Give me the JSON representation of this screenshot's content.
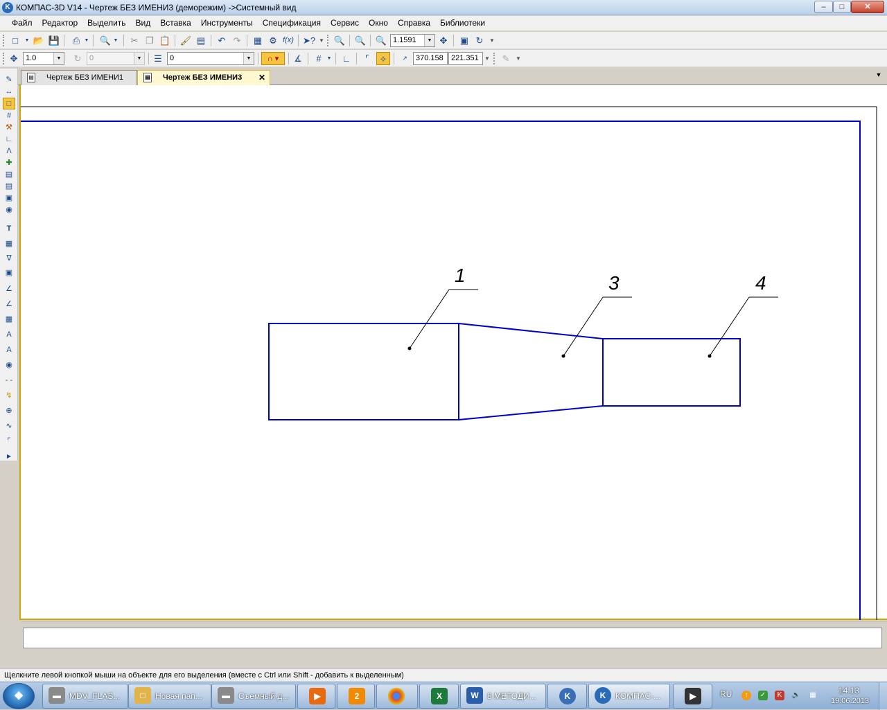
{
  "window": {
    "title": "КОМПАС-3D V14 - Чертеж БЕЗ ИМЕНИ3 (деморежим) ->Системный вид",
    "app_icon_letter": "K"
  },
  "menu": [
    "Файл",
    "Редактор",
    "Выделить",
    "Вид",
    "Вставка",
    "Инструменты",
    "Спецификация",
    "Сервис",
    "Окно",
    "Справка",
    "Библиотеки"
  ],
  "toolbar1": {
    "zoom_value": "1.1591"
  },
  "toolbar2": {
    "step_value": "1.0",
    "angle_value": "0",
    "layer_value": "0",
    "coord_x": "370.158",
    "coord_y": "221.351"
  },
  "tabs": [
    {
      "label": "Чертеж БЕЗ ИМЕНИ1",
      "active": false
    },
    {
      "label": "Чертеж БЕЗ ИМЕНИ3",
      "active": true
    }
  ],
  "drawing": {
    "labels": [
      "1",
      "3",
      "4"
    ],
    "line_color": "#0000cc"
  },
  "status": {
    "hint": "Щелкните левой кнопкой мыши на объекте для его выделения (вместе с Ctrl или Shift - добавить к выделенным)"
  },
  "taskbar": {
    "tasks": [
      {
        "label": "MDV_FLAS...",
        "icon": "drive-icon"
      },
      {
        "label": "Новая пап...",
        "icon": "folder-icon"
      },
      {
        "label": "Съемный д...",
        "icon": "drive-icon"
      },
      {
        "label": "",
        "icon": "media-player-icon"
      },
      {
        "label": "",
        "icon": "messenger-icon"
      },
      {
        "label": "",
        "icon": "chrome-icon"
      },
      {
        "label": "",
        "icon": "excel-icon"
      },
      {
        "label": "8 МЕТОДИ...",
        "icon": "word-icon"
      },
      {
        "label": "",
        "icon": "kompas-viewer-icon"
      },
      {
        "label": "КОМПАС-...",
        "icon": "kompas-icon"
      },
      {
        "label": "",
        "icon": "media-player-classic-icon"
      }
    ],
    "lang": "RU",
    "time": "14:13",
    "date": "19.06.2013"
  }
}
